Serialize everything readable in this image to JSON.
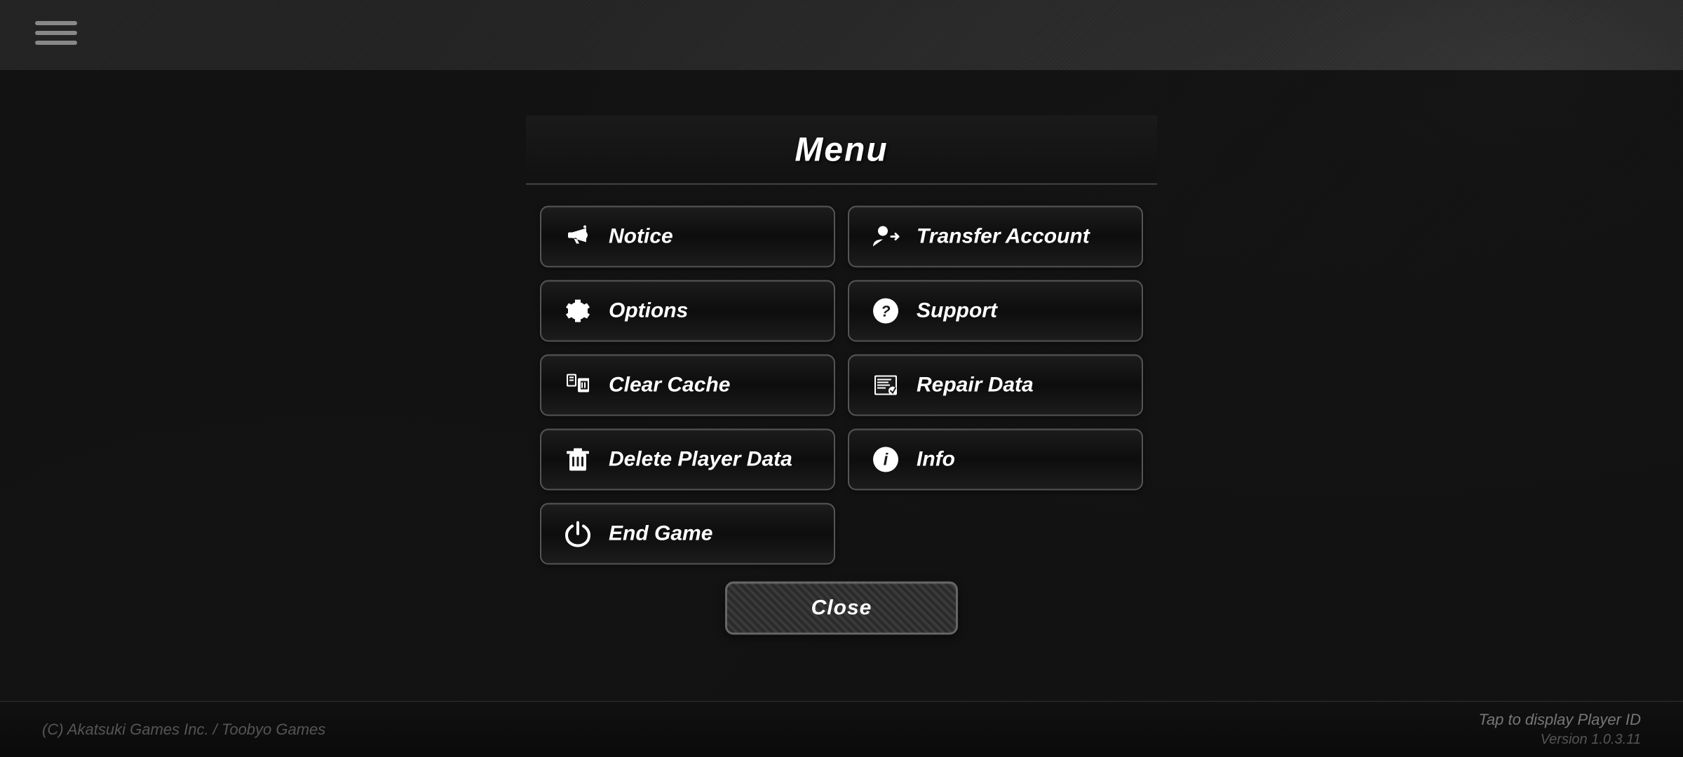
{
  "app": {
    "title": "Menu"
  },
  "hamburger": {
    "label": "hamburger menu"
  },
  "buttons": {
    "left": [
      {
        "id": "notice",
        "label": "Notice",
        "icon": "megaphone"
      },
      {
        "id": "options",
        "label": "Options",
        "icon": "gear"
      },
      {
        "id": "clear-cache",
        "label": "Clear Cache",
        "icon": "clear-cache"
      },
      {
        "id": "delete-player-data",
        "label": "Delete Player Data",
        "icon": "trash"
      },
      {
        "id": "end-game",
        "label": "End Game",
        "icon": "power"
      }
    ],
    "right": [
      {
        "id": "transfer-account",
        "label": "Transfer Account",
        "icon": "transfer"
      },
      {
        "id": "support",
        "label": "Support",
        "icon": "question"
      },
      {
        "id": "repair-data",
        "label": "Repair Data",
        "icon": "repair"
      },
      {
        "id": "info",
        "label": "Info",
        "icon": "info"
      }
    ]
  },
  "close_button": {
    "label": "Close"
  },
  "footer": {
    "copyright": "(C) Akatsuki Games Inc. / Toobyo Games",
    "tap_player_id": "Tap to display Player ID",
    "version": "Version 1.0.3.11"
  }
}
